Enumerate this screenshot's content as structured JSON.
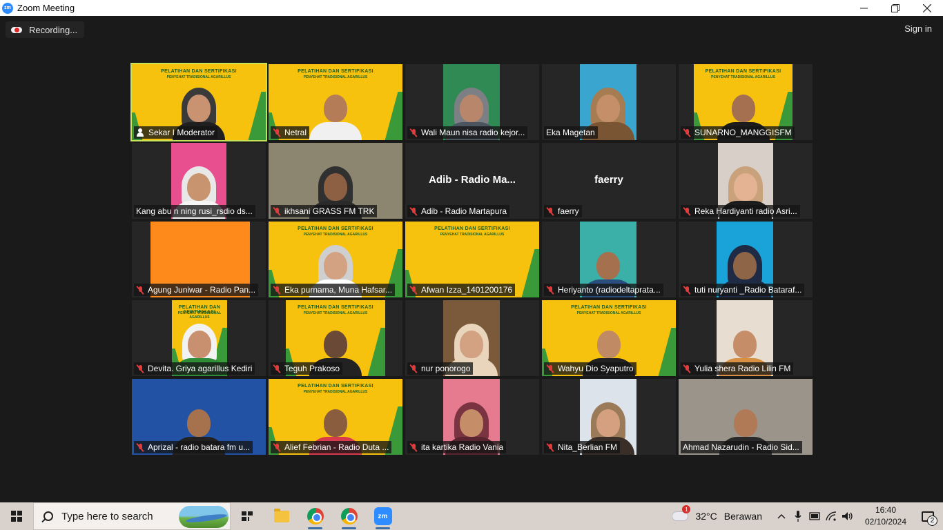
{
  "window": {
    "app_icon_text": "zm",
    "title": "Zoom Meeting",
    "controls": [
      "minimize",
      "restore",
      "close"
    ]
  },
  "topbar": {
    "recording_label": "Recording...",
    "signin_label": "Sign in"
  },
  "participants": [
    {
      "name": "Sekar I Moderator",
      "muted": false,
      "host": true,
      "active": true,
      "video": "banner"
    },
    {
      "name": "Netral",
      "muted": true,
      "video": "banner"
    },
    {
      "name": "Wali Maun nisa radio kejor...",
      "muted": true,
      "video": "camera"
    },
    {
      "name": "Eka Magetan",
      "muted": false,
      "video": "camera"
    },
    {
      "name": "SUNARNO_MANGGISFM",
      "muted": true,
      "video": "banner"
    },
    {
      "name": "Kang abu n ning rusi_rsdio ds...",
      "muted": false,
      "video": "camera"
    },
    {
      "name": "ikhsani GRASS FM TRK",
      "muted": true,
      "video": "camera"
    },
    {
      "name": "Adib - Radio Martapura",
      "muted": true,
      "video": "off",
      "display_name": "Adib - Radio Ma..."
    },
    {
      "name": "faerry",
      "muted": true,
      "video": "off",
      "display_name": "faerry"
    },
    {
      "name": "Reka Hardiyanti radio Asri...",
      "muted": true,
      "video": "camera"
    },
    {
      "name": "Agung Juniwar - Radio Pan...",
      "muted": true,
      "video": "orange"
    },
    {
      "name": "Eka purnama, Muna Hafsar...",
      "muted": true,
      "video": "banner"
    },
    {
      "name": "Afwan Izza_1401200176",
      "muted": true,
      "video": "banner"
    },
    {
      "name": "Heriyanto (radiodeltaprata...",
      "muted": true,
      "video": "camera"
    },
    {
      "name": "tuti nuryanti _Radio Bataraf...",
      "muted": true,
      "video": "camera"
    },
    {
      "name": "Devita. Griya agarillus Kediri",
      "muted": true,
      "video": "banner"
    },
    {
      "name": "Teguh Prakoso",
      "muted": true,
      "video": "banner"
    },
    {
      "name": "nur ponorogo",
      "muted": true,
      "video": "camera"
    },
    {
      "name": "Wahyu Dio Syaputro",
      "muted": true,
      "video": "banner"
    },
    {
      "name": "Yulia shera Radio Lilin FM",
      "muted": true,
      "video": "camera"
    },
    {
      "name": "Aprizal - radio batara fm u...",
      "muted": true,
      "video": "camera"
    },
    {
      "name": "Alief Febrian - Radio Duta ...",
      "muted": true,
      "video": "banner"
    },
    {
      "name": "ita kartika Radio Vania",
      "muted": true,
      "video": "camera"
    },
    {
      "name": "Nita_Berlian FM",
      "muted": true,
      "video": "camera"
    },
    {
      "name": "Ahmad Nazarudin - Radio Sid...",
      "muted": false,
      "video": "camera"
    }
  ],
  "banner_text": {
    "line1": "PELATIHAN DAN SERTIFIKASI",
    "line2": "PENYEHAT TRADISIONAL AGARILLUS"
  },
  "taskbar": {
    "search_placeholder": "Type here to search",
    "weather_temp": "32°C",
    "weather_desc": "Berawan",
    "weather_badge": "1",
    "time": "16:40",
    "date": "02/10/2024",
    "notification_count": "2"
  },
  "colors": {
    "banner_yellow": "#f7c20e",
    "active_outline": "#c8e35a",
    "muted_red": "#e23b3b",
    "zoom_blue": "#2d8cff"
  }
}
